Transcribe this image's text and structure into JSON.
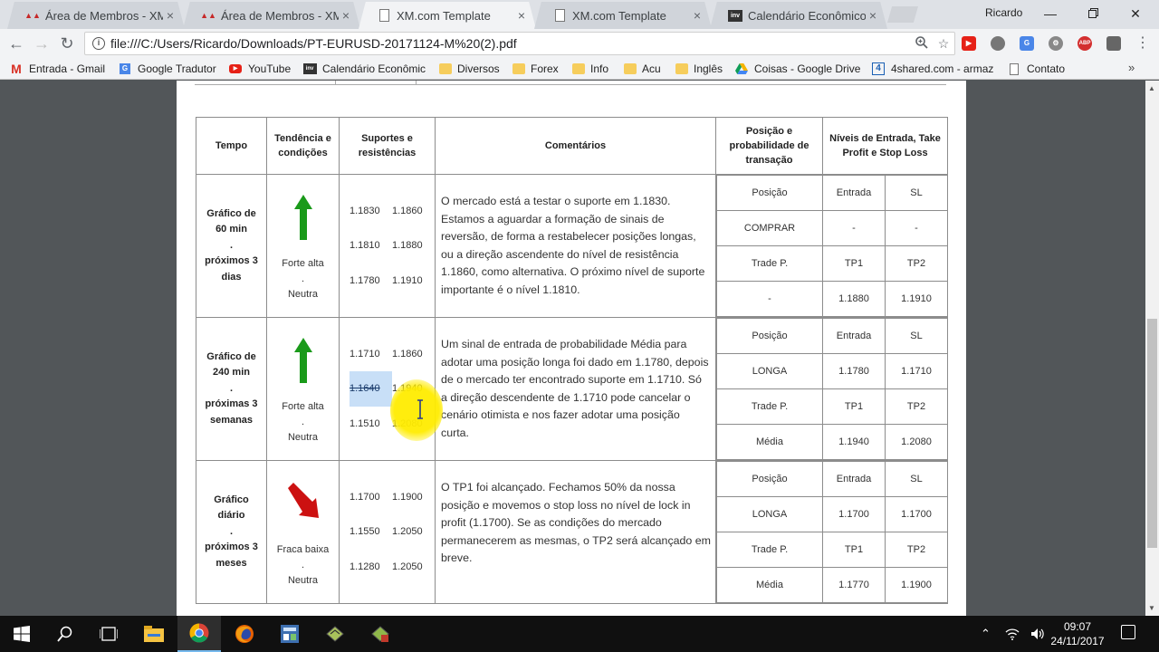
{
  "browser": {
    "tabs": [
      {
        "title": "Área de Membros - XM.c",
        "icon": "xm-favicon",
        "active": false
      },
      {
        "title": "Área de Membros - XM.c",
        "icon": "xm-favicon",
        "active": false
      },
      {
        "title": "XM.com Template",
        "icon": "document-icon",
        "active": true
      },
      {
        "title": "XM.com Template",
        "icon": "document-icon",
        "active": false
      },
      {
        "title": "Calendário Econômico -",
        "icon": "investing-favicon",
        "active": false
      }
    ],
    "profile_name": "Ricardo",
    "url": "file:///C:/Users/Ricardo/Downloads/PT-EURUSD-20171124-M%20(2).pdf",
    "bookmarks": [
      {
        "label": "Entrada - Gmail",
        "icon": "gmail-icon"
      },
      {
        "label": "Google Tradutor",
        "icon": "translate-icon"
      },
      {
        "label": "YouTube",
        "icon": "youtube-icon"
      },
      {
        "label": "Calendário Econômic",
        "icon": "investing-icon"
      },
      {
        "label": "Diversos",
        "icon": "folder-icon"
      },
      {
        "label": "Forex",
        "icon": "folder-icon"
      },
      {
        "label": "Info",
        "icon": "folder-icon"
      },
      {
        "label": "Acu",
        "icon": "folder-icon"
      },
      {
        "label": "Inglês",
        "icon": "folder-icon"
      },
      {
        "label": "Coisas - Google Drive",
        "icon": "drive-icon"
      },
      {
        "label": "4shared.com - armaz",
        "icon": "4shared-icon"
      },
      {
        "label": "Contato",
        "icon": "page-icon"
      }
    ],
    "bookmarks_more": "»"
  },
  "table": {
    "headers": {
      "tempo": "Tempo",
      "tendencia": "Tendência e condições",
      "suportes": "Suportes e resistências",
      "comentarios": "Comentários",
      "posicao": "Posição e probabilidade de transação",
      "niveis": "Níveis de Entrada, Take Profit e Stop Loss"
    },
    "rows": [
      {
        "tempo_lines": [
          "Gráfico de",
          "60 min",
          ".",
          "próximos 3",
          "dias"
        ],
        "trend": "up",
        "trend_color": "#1a9a1a",
        "trend_lines": [
          "Forte alta",
          ".",
          "Neutra"
        ],
        "sr": [
          [
            "1.1830",
            "1.1860"
          ],
          [
            "1.1810",
            "1.1880"
          ],
          [
            "1.1780",
            "1.1910"
          ]
        ],
        "comment": "O mercado está a testar o suporte em 1.1830. Estamos a aguardar a formação de sinais de reversão, de forma a restabelecer posições longas, ou a direção ascendente do nível de resistência 1.1860, como alternativa. O próximo nível de suporte importante é o nível 1.1810.",
        "pos": [
          [
            "Posição",
            "Entrada",
            "SL"
          ],
          [
            "COMPRAR",
            "-",
            "-"
          ],
          [
            "Trade P.",
            "TP1",
            "TP2"
          ],
          [
            "-",
            "1.1880",
            "1.1910"
          ]
        ]
      },
      {
        "tempo_lines": [
          "Gráfico de",
          "240 min",
          ".",
          "próximas 3",
          "semanas"
        ],
        "trend": "up",
        "trend_color": "#1a9a1a",
        "trend_lines": [
          "Forte alta",
          ".",
          "Neutra"
        ],
        "sr": [
          [
            "1.1710",
            "1.1860"
          ],
          [
            "1.1640",
            "1.1940"
          ],
          [
            "1.1510",
            "1.2080"
          ]
        ],
        "comment": "Um sinal de entrada de probabilidade Média para adotar uma posição longa foi dado em 1.1780, depois de o mercado ter encontrado suporte em 1.1710. Só a direção descendente de 1.1710 pode cancelar o cenário otimista e nos fazer adotar uma posição curta.",
        "pos": [
          [
            "Posição",
            "Entrada",
            "SL"
          ],
          [
            "LONGA",
            "1.1780",
            "1.1710"
          ],
          [
            "Trade P.",
            "TP1",
            "TP2"
          ],
          [
            "Média",
            "1.1940",
            "1.2080"
          ]
        ]
      },
      {
        "tempo_lines": [
          "Gráfico",
          "diário",
          ".",
          "próximos 3",
          "meses"
        ],
        "trend": "down",
        "trend_color": "#cc1111",
        "trend_lines": [
          "Fraca baixa",
          ".",
          "Neutra"
        ],
        "sr": [
          [
            "1.1700",
            "1.1900"
          ],
          [
            "1.1550",
            "1.2050"
          ],
          [
            "1.1280",
            "1.2050"
          ]
        ],
        "comment": "O TP1 foi alcançado. Fechamos 50% da nossa posição e movemos o stop loss no nível de lock in profit (1.1700). Se as condições do mercado permanecerem as mesmas, o TP2 será alcançado em breve.",
        "pos": [
          [
            "Posição",
            "Entrada",
            "SL"
          ],
          [
            "LONGA",
            "1.1700",
            "1.1700"
          ],
          [
            "Trade P.",
            "TP1",
            "TP2"
          ],
          [
            "Média",
            "1.1770",
            "1.1900"
          ]
        ]
      }
    ]
  },
  "taskbar": {
    "clock_time": "09:07",
    "clock_date": "24/11/2017"
  }
}
